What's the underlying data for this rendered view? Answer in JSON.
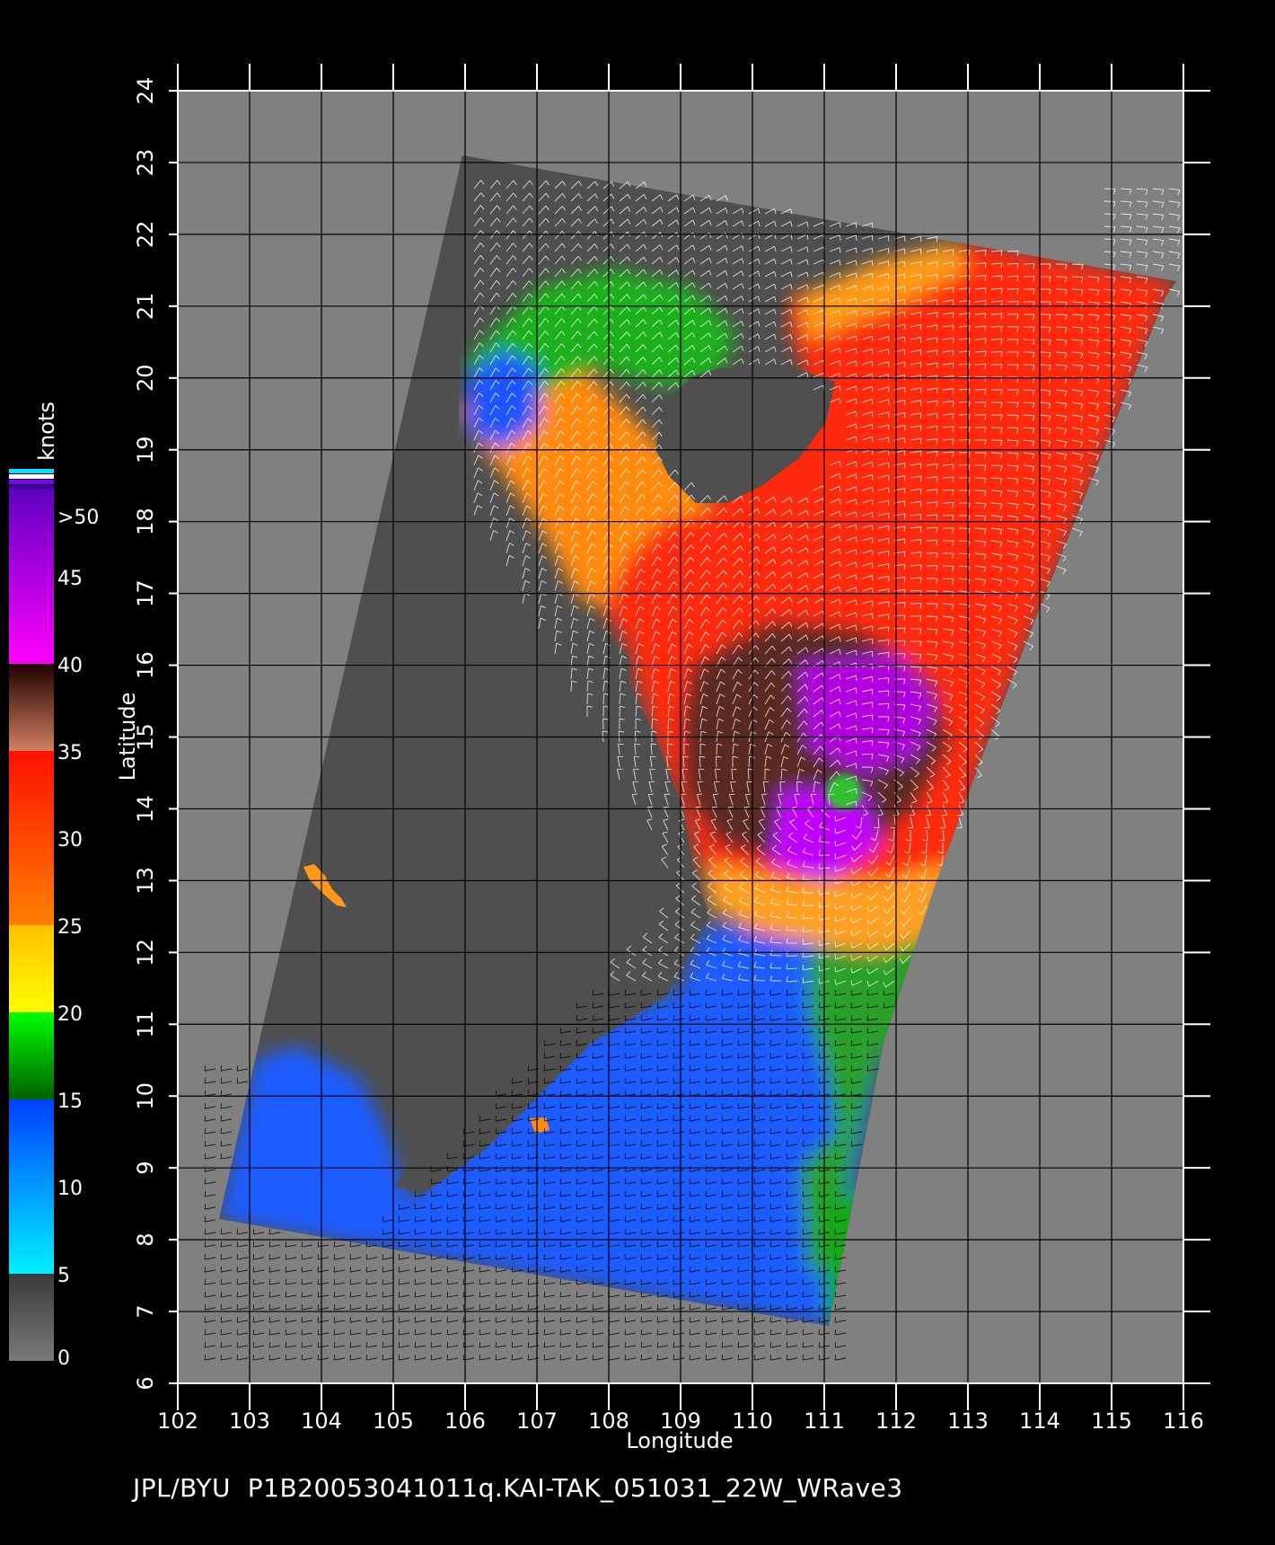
{
  "map": {
    "xlabel": "Longitude",
    "ylabel": "Latitude",
    "lon_ticks": [
      "102",
      "103",
      "104",
      "105",
      "106",
      "107",
      "108",
      "109",
      "110",
      "111",
      "112",
      "113",
      "114",
      "115",
      "116"
    ],
    "lat_ticks": [
      "6",
      "7",
      "8",
      "9",
      "10",
      "11",
      "12",
      "13",
      "14",
      "15",
      "16",
      "17",
      "18",
      "19",
      "20",
      "21",
      "22",
      "23",
      "24"
    ],
    "lon_range": [
      102,
      116
    ],
    "lat_range": [
      6,
      24
    ],
    "storm_center": {
      "lon": 111.3,
      "lat": 14.0
    }
  },
  "colorbar": {
    "unit": "knots",
    "labels": [
      "0",
      "5",
      "10",
      "15",
      "20",
      "25",
      "30",
      "35",
      "40",
      "45",
      ">50"
    ],
    "bands": [
      {
        "from": 0,
        "to": 5,
        "colors": [
          "#7a7a7a",
          "#3a3a3a"
        ]
      },
      {
        "from": 5,
        "to": 15,
        "colors": [
          "#00f0ff",
          "#0040ff"
        ]
      },
      {
        "from": 15,
        "to": 20,
        "colors": [
          "#006000",
          "#00ff00"
        ]
      },
      {
        "from": 20,
        "to": 25,
        "colors": [
          "#ffff00",
          "#ffc000"
        ]
      },
      {
        "from": 25,
        "to": 35,
        "colors": [
          "#ff8000",
          "#ff1000"
        ]
      },
      {
        "from": 35,
        "to": 40,
        "colors": [
          "#d08060",
          "#200000"
        ]
      },
      {
        "from": 40,
        "to": 50,
        "colors": [
          "#ff00ff",
          "#6000c0"
        ]
      }
    ]
  },
  "footer": "JPL/BYU  P1B20053041011q.KAI-TAK_051031_22W_WRave3"
}
